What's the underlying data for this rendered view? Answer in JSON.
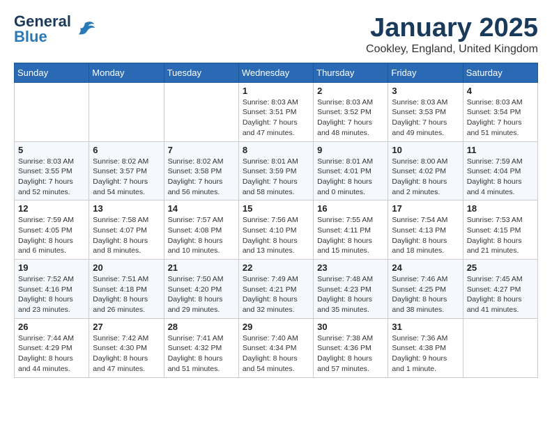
{
  "header": {
    "logo_general": "General",
    "logo_blue": "Blue",
    "month_title": "January 2025",
    "location": "Cookley, England, United Kingdom"
  },
  "weekdays": [
    "Sunday",
    "Monday",
    "Tuesday",
    "Wednesday",
    "Thursday",
    "Friday",
    "Saturday"
  ],
  "weeks": [
    [
      {
        "day": "",
        "info": ""
      },
      {
        "day": "",
        "info": ""
      },
      {
        "day": "",
        "info": ""
      },
      {
        "day": "1",
        "info": "Sunrise: 8:03 AM\nSunset: 3:51 PM\nDaylight: 7 hours and 47 minutes."
      },
      {
        "day": "2",
        "info": "Sunrise: 8:03 AM\nSunset: 3:52 PM\nDaylight: 7 hours and 48 minutes."
      },
      {
        "day": "3",
        "info": "Sunrise: 8:03 AM\nSunset: 3:53 PM\nDaylight: 7 hours and 49 minutes."
      },
      {
        "day": "4",
        "info": "Sunrise: 8:03 AM\nSunset: 3:54 PM\nDaylight: 7 hours and 51 minutes."
      }
    ],
    [
      {
        "day": "5",
        "info": "Sunrise: 8:03 AM\nSunset: 3:55 PM\nDaylight: 7 hours and 52 minutes."
      },
      {
        "day": "6",
        "info": "Sunrise: 8:02 AM\nSunset: 3:57 PM\nDaylight: 7 hours and 54 minutes."
      },
      {
        "day": "7",
        "info": "Sunrise: 8:02 AM\nSunset: 3:58 PM\nDaylight: 7 hours and 56 minutes."
      },
      {
        "day": "8",
        "info": "Sunrise: 8:01 AM\nSunset: 3:59 PM\nDaylight: 7 hours and 58 minutes."
      },
      {
        "day": "9",
        "info": "Sunrise: 8:01 AM\nSunset: 4:01 PM\nDaylight: 8 hours and 0 minutes."
      },
      {
        "day": "10",
        "info": "Sunrise: 8:00 AM\nSunset: 4:02 PM\nDaylight: 8 hours and 2 minutes."
      },
      {
        "day": "11",
        "info": "Sunrise: 7:59 AM\nSunset: 4:04 PM\nDaylight: 8 hours and 4 minutes."
      }
    ],
    [
      {
        "day": "12",
        "info": "Sunrise: 7:59 AM\nSunset: 4:05 PM\nDaylight: 8 hours and 6 minutes."
      },
      {
        "day": "13",
        "info": "Sunrise: 7:58 AM\nSunset: 4:07 PM\nDaylight: 8 hours and 8 minutes."
      },
      {
        "day": "14",
        "info": "Sunrise: 7:57 AM\nSunset: 4:08 PM\nDaylight: 8 hours and 10 minutes."
      },
      {
        "day": "15",
        "info": "Sunrise: 7:56 AM\nSunset: 4:10 PM\nDaylight: 8 hours and 13 minutes."
      },
      {
        "day": "16",
        "info": "Sunrise: 7:55 AM\nSunset: 4:11 PM\nDaylight: 8 hours and 15 minutes."
      },
      {
        "day": "17",
        "info": "Sunrise: 7:54 AM\nSunset: 4:13 PM\nDaylight: 8 hours and 18 minutes."
      },
      {
        "day": "18",
        "info": "Sunrise: 7:53 AM\nSunset: 4:15 PM\nDaylight: 8 hours and 21 minutes."
      }
    ],
    [
      {
        "day": "19",
        "info": "Sunrise: 7:52 AM\nSunset: 4:16 PM\nDaylight: 8 hours and 23 minutes."
      },
      {
        "day": "20",
        "info": "Sunrise: 7:51 AM\nSunset: 4:18 PM\nDaylight: 8 hours and 26 minutes."
      },
      {
        "day": "21",
        "info": "Sunrise: 7:50 AM\nSunset: 4:20 PM\nDaylight: 8 hours and 29 minutes."
      },
      {
        "day": "22",
        "info": "Sunrise: 7:49 AM\nSunset: 4:21 PM\nDaylight: 8 hours and 32 minutes."
      },
      {
        "day": "23",
        "info": "Sunrise: 7:48 AM\nSunset: 4:23 PM\nDaylight: 8 hours and 35 minutes."
      },
      {
        "day": "24",
        "info": "Sunrise: 7:46 AM\nSunset: 4:25 PM\nDaylight: 8 hours and 38 minutes."
      },
      {
        "day": "25",
        "info": "Sunrise: 7:45 AM\nSunset: 4:27 PM\nDaylight: 8 hours and 41 minutes."
      }
    ],
    [
      {
        "day": "26",
        "info": "Sunrise: 7:44 AM\nSunset: 4:29 PM\nDaylight: 8 hours and 44 minutes."
      },
      {
        "day": "27",
        "info": "Sunrise: 7:42 AM\nSunset: 4:30 PM\nDaylight: 8 hours and 47 minutes."
      },
      {
        "day": "28",
        "info": "Sunrise: 7:41 AM\nSunset: 4:32 PM\nDaylight: 8 hours and 51 minutes."
      },
      {
        "day": "29",
        "info": "Sunrise: 7:40 AM\nSunset: 4:34 PM\nDaylight: 8 hours and 54 minutes."
      },
      {
        "day": "30",
        "info": "Sunrise: 7:38 AM\nSunset: 4:36 PM\nDaylight: 8 hours and 57 minutes."
      },
      {
        "day": "31",
        "info": "Sunrise: 7:36 AM\nSunset: 4:38 PM\nDaylight: 9 hours and 1 minute."
      },
      {
        "day": "",
        "info": ""
      }
    ]
  ]
}
